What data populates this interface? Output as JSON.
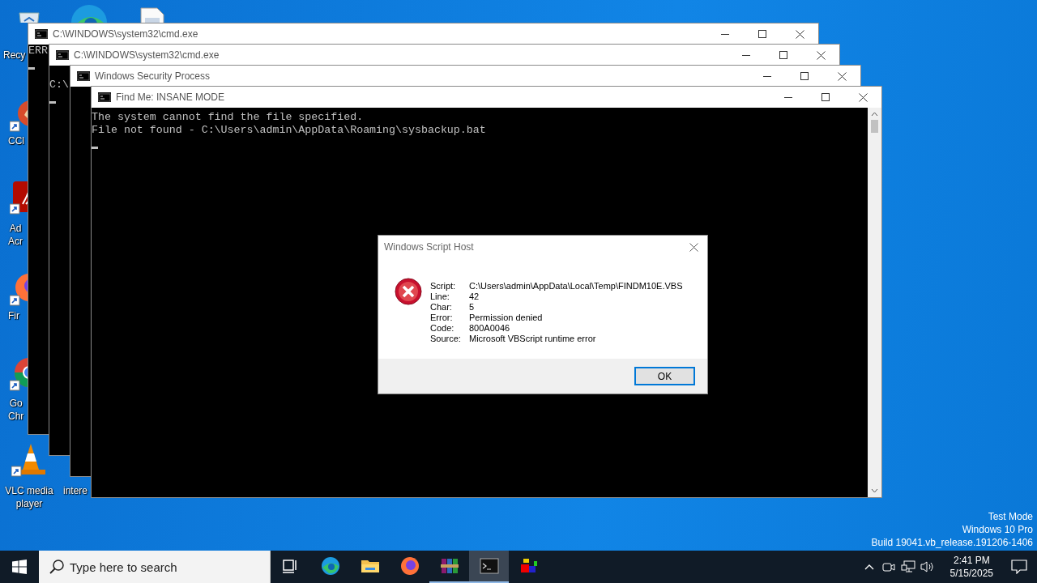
{
  "desktop": {
    "icons": [
      {
        "kind": "recycle",
        "label": [
          "Recy"
        ]
      },
      {
        "kind": "edge"
      },
      {
        "kind": "file"
      },
      {
        "kind": "cleaner",
        "label": [
          "CCl"
        ]
      },
      {
        "kind": "pdf",
        "label": [
          "Ad",
          "Acr"
        ]
      },
      {
        "kind": "firefox",
        "label": [
          "Fir"
        ]
      },
      {
        "kind": "chrome",
        "label": [
          "Go",
          "Chr"
        ]
      },
      {
        "kind": "cone",
        "label": [
          "VLC media",
          "player"
        ]
      },
      {
        "kind": "hidden",
        "label": [
          "intere"
        ]
      }
    ],
    "os_info": [
      "Test Mode",
      "Windows 10 Pro",
      "Build 19041.vb_release.191206-1406"
    ]
  },
  "windows": [
    {
      "title": "C:\\WINDOWS\\system32\\cmd.exe",
      "lines": [
        "ERR"
      ],
      "cursor": true
    },
    {
      "title": "C:\\WINDOWS\\system32\\cmd.exe",
      "lines": [
        "C:\\"
      ],
      "cursor": true
    },
    {
      "title": "Windows Security Process",
      "cursor": false
    },
    {
      "title": "Find Me: INSANE MODE",
      "lines": [
        "The system cannot find the file specified.",
        "File not found - C:\\Users\\admin\\AppData\\Roaming\\sysbackup.bat"
      ],
      "cursor": true
    }
  ],
  "dialog": {
    "title": "Windows Script Host",
    "fields": [
      {
        "label": "Script:",
        "value": "C:\\Users\\admin\\AppData\\Local\\Temp\\FINDM10E.VBS"
      },
      {
        "label": "Line:",
        "value": "42"
      },
      {
        "label": "Char:",
        "value": "5"
      },
      {
        "label": "Error:",
        "value": "Permission denied"
      },
      {
        "label": "Code:",
        "value": "800A0046"
      },
      {
        "label": "Source:",
        "value": "Microsoft VBScript runtime error"
      }
    ],
    "button": "OK"
  },
  "taskbar": {
    "search": {
      "placeholder": "Type here to search"
    },
    "apps": [
      {
        "kind": "taskview",
        "running": false,
        "selected": false
      },
      {
        "kind": "edge",
        "running": false,
        "selected": false
      },
      {
        "kind": "folder",
        "running": false,
        "selected": false
      },
      {
        "kind": "firefox",
        "running": false,
        "selected": false
      },
      {
        "kind": "archive",
        "running": true,
        "selected": false
      },
      {
        "kind": "terminal",
        "running": true,
        "selected": true
      },
      {
        "kind": "cubes",
        "running": false,
        "selected": false
      }
    ],
    "clock": {
      "time": "2:41 PM",
      "date": "5/15/2025"
    }
  }
}
